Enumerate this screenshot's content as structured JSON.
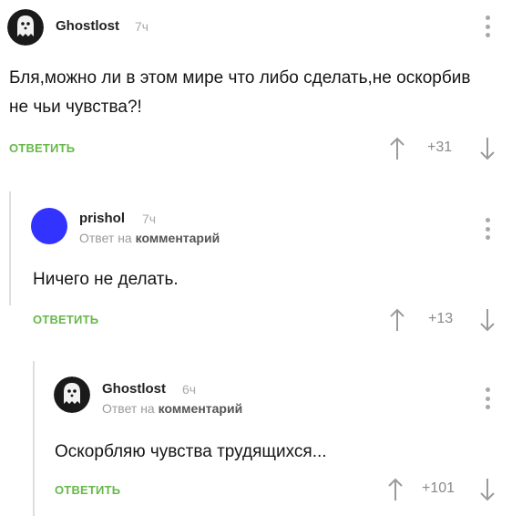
{
  "comments": [
    {
      "username": "Ghostlost",
      "time": "7ч",
      "text": "Бля,можно ли в этом мире что либо сделать,не оскорбив не чьи чувства?!",
      "reply": "ОТВЕТИТЬ",
      "score": "+31",
      "avatar": "ghost-avatar"
    },
    {
      "username": "prishol",
      "time": "7ч",
      "reply_to_prefix": "Ответ на",
      "reply_to_link": "комментарий",
      "text": "Ничего не делать.",
      "reply": "ОТВЕТИТЬ",
      "score": "+13",
      "avatar": "blue-circle-avatar",
      "avatar_color": "#3333ff"
    },
    {
      "username": "Ghostlost",
      "time": "6ч",
      "reply_to_prefix": "Ответ на",
      "reply_to_link": "комментарий",
      "text": "Оскорбляю чувства трудящихся...",
      "reply": "ОТВЕТИТЬ",
      "score": "+101",
      "avatar": "ghost-avatar"
    }
  ],
  "colors": {
    "reply_green": "#67b84a",
    "score_gray": "#8a8a8a",
    "arrow_gray": "#9a9a9a"
  }
}
